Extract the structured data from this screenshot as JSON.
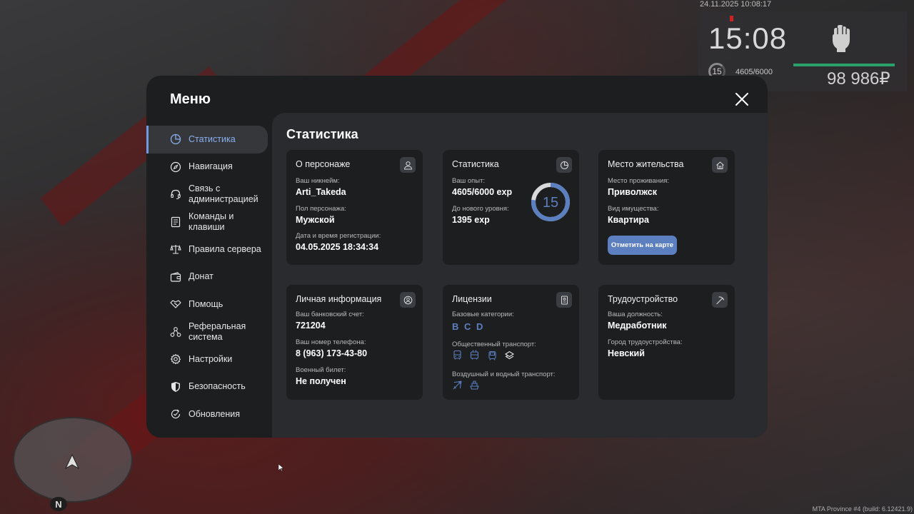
{
  "hud": {
    "datetime": "24.11.2025 10:08:17",
    "time": "15:08",
    "level": "15",
    "exp": "4605/6000",
    "money": "98 986₽",
    "health_percent": 100
  },
  "minimap": {
    "north": "N"
  },
  "build_info": "MTA Province #4 (build: 6.12421.9)",
  "menu": {
    "title": "Меню",
    "sidebar": [
      {
        "label": "Статистика",
        "icon": "pie-chart-icon",
        "active": true
      },
      {
        "label": "Навигация",
        "icon": "compass-icon"
      },
      {
        "label": "Связь с администрацией",
        "icon": "headset-icon"
      },
      {
        "label": "Команды и клавиши",
        "icon": "document-list-icon"
      },
      {
        "label": "Правила сервера",
        "icon": "scales-icon"
      },
      {
        "label": "Донат",
        "icon": "wallet-icon"
      },
      {
        "label": "Помощь",
        "icon": "handshake-icon"
      },
      {
        "label": "Реферальная система",
        "icon": "referral-icon"
      },
      {
        "label": "Настройки",
        "icon": "gear-icon"
      },
      {
        "label": "Безопасность",
        "icon": "shield-icon"
      },
      {
        "label": "Обновления",
        "icon": "refresh-check-icon"
      }
    ]
  },
  "page": {
    "title": "Статистика",
    "character": {
      "title": "О персонаже",
      "nickname_label": "Ваш никнейм:",
      "nickname": "Arti_Takeda",
      "gender_label": "Пол персонажа:",
      "gender": "Мужской",
      "reg_label": "Дата и время регистрации:",
      "reg_date": "04.05.2025 18:34:34"
    },
    "stats": {
      "title": "Статистика",
      "exp_label": "Ваш опыт:",
      "exp": "4605/6000 exp",
      "next_label": "До нового уровня:",
      "next": "1395 exp",
      "level": "15",
      "level_progress": 0.7675
    },
    "residence": {
      "title": "Место жительства",
      "place_label": "Место проживания:",
      "place": "Приволжск",
      "property_label": "Вид имущества:",
      "property": "Квартира",
      "map_button": "Отметить на карте"
    },
    "personal": {
      "title": "Личная информация",
      "bank_label": "Ваш банковский счет:",
      "bank": "721204",
      "phone_label": "Ваш номер телефона:",
      "phone": "8 (963) 173-43-80",
      "military_label": "Военный билет:",
      "military": "Не получен"
    },
    "licenses": {
      "title": "Лицензии",
      "base_label": "Базовые категории:",
      "categories": [
        "B",
        "C",
        "D"
      ],
      "public_label": "Общественный транспорт:",
      "public_icons": [
        "bus-icon",
        "trolleybus-icon",
        "tram-icon",
        "taxi-icon"
      ],
      "air_water_label": "Воздушный и водный транспорт:",
      "air_water_icons": [
        "plane-icon",
        "boat-icon"
      ]
    },
    "employment": {
      "title": "Трудоустройство",
      "position_label": "Ваша должность:",
      "position": "Медработник",
      "city_label": "Город трудоустройства:",
      "city": "Невский"
    }
  },
  "colors": {
    "accent": "#5b7fbf",
    "accent_light": "#8ab0f0",
    "window_bg": "#1d1e20",
    "content_bg": "#2a2b2e",
    "health": "#2aa06a"
  }
}
